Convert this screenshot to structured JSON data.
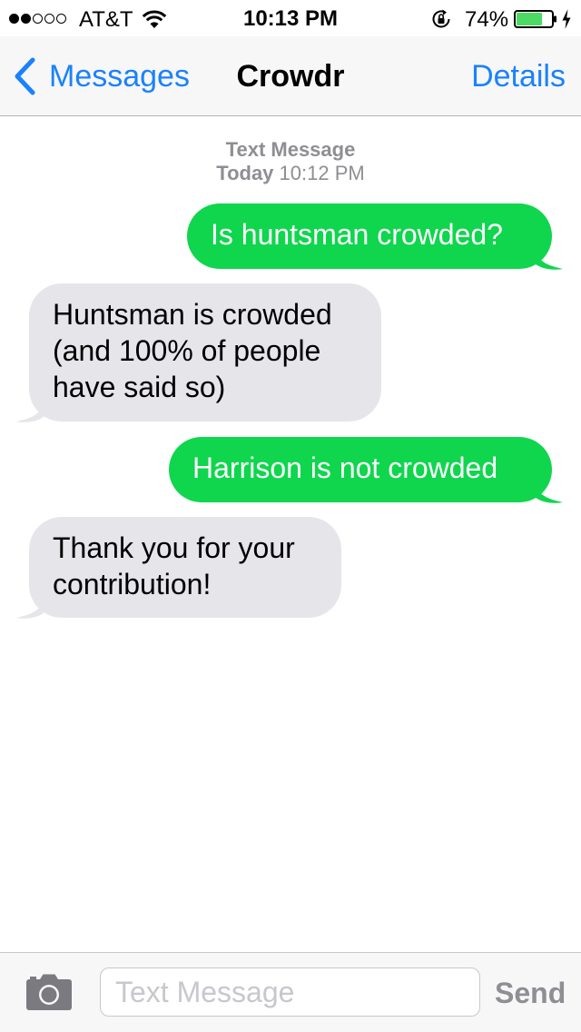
{
  "status_bar": {
    "signal_bars_filled": 2,
    "signal_bars_total": 5,
    "carrier": "AT&T",
    "time": "10:13 PM",
    "battery_percent": "74%",
    "battery_level": 0.74,
    "charging": true,
    "icons": [
      "signal-dots",
      "wifi-icon",
      "rotation-lock-icon",
      "battery-icon",
      "charging-icon"
    ]
  },
  "nav": {
    "back_label": "Messages",
    "title": "Crowdr",
    "details_label": "Details",
    "back_icon": "chevron-left-icon"
  },
  "conversation": {
    "service_label": "Text Message",
    "day": "Today",
    "time": "10:12 PM",
    "messages": [
      {
        "direction": "sent",
        "text": "Is huntsman crowded?"
      },
      {
        "direction": "received",
        "text": "Huntsman is crowded (and 100% of people have said so)"
      },
      {
        "direction": "sent",
        "text": "Harrison is not crowded"
      },
      {
        "direction": "received",
        "text": "Thank you for your contribution!"
      }
    ]
  },
  "input_bar": {
    "camera_icon": "camera-icon",
    "placeholder": "Text Message",
    "value": "",
    "send_label": "Send"
  },
  "colors": {
    "accent_blue": "#1a82fb",
    "sent_bubble": "#0fd64d",
    "received_bubble": "#e5e5ea",
    "battery_fill": "#4cd964",
    "secondary_text": "#8e8e93"
  }
}
